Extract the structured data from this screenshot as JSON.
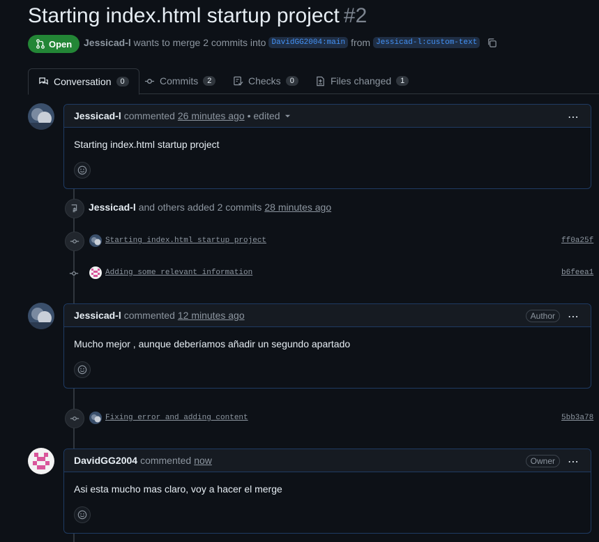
{
  "pr": {
    "title": "Starting index.html startup project",
    "number": "#2",
    "state": "Open",
    "author": "Jessicad-l",
    "merge_text": "wants to merge 2 commits into",
    "base_branch": "DavidGG2004:main",
    "from_text": "from",
    "head_branch": "Jessicad-l:custom-text"
  },
  "tabs": [
    {
      "label": "Conversation",
      "count": "0"
    },
    {
      "label": "Commits",
      "count": "2"
    },
    {
      "label": "Checks",
      "count": "0"
    },
    {
      "label": "Files changed",
      "count": "1"
    }
  ],
  "comments": [
    {
      "author": "Jessicad-l",
      "action": "commented",
      "time": "26 minutes ago",
      "edited": "• edited",
      "body": "Starting index.html startup project",
      "badge": ""
    },
    {
      "author": "Jessicad-l",
      "action": "commented",
      "time": "12 minutes ago",
      "body": "Mucho mejor , aunque deberíamos añadir un segundo apartado",
      "badge": "Author"
    },
    {
      "author": "DavidGG2004",
      "action": "commented",
      "time": "now",
      "body": "Asi esta mucho mas claro, voy a hacer el merge",
      "badge": "Owner"
    }
  ],
  "push_event": {
    "author": "Jessicad-l",
    "text": "and others added 2 commits",
    "time": "28 minutes ago"
  },
  "commits": [
    {
      "message": "Starting index.html startup project",
      "sha": "ff0a25f"
    },
    {
      "message": "Adding some relevant information",
      "sha": "b6feea1"
    },
    {
      "message": "Fixing error and adding content",
      "sha": "5bb3a78"
    }
  ],
  "colors": {
    "open": "#238636",
    "accent": "#4493f8",
    "background": "#0d1117"
  }
}
